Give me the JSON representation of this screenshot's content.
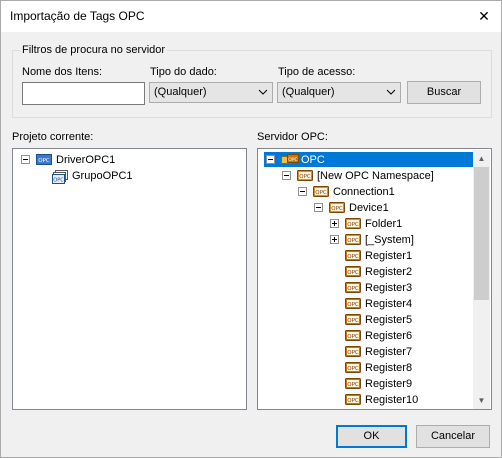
{
  "window": {
    "title": "Importação de Tags OPC",
    "close_glyph": "✕"
  },
  "filters": {
    "group_title": "Filtros de procura no servidor",
    "item_names_label": "Nome dos Itens:",
    "item_names_value": "",
    "data_type_label": "Tipo do dado:",
    "data_type_value": "(Qualquer)",
    "access_type_label": "Tipo de acesso:",
    "access_type_value": "(Qualquer)",
    "search_button": "Buscar"
  },
  "current_project": {
    "label": "Projeto corrente:",
    "items": [
      {
        "label": "DriverOPC1",
        "icon": "opc-driver-icon",
        "level": 0,
        "expander": "minus"
      },
      {
        "label": "GrupoOPC1",
        "icon": "opc-group-icon",
        "level": 1,
        "expander": "none"
      }
    ]
  },
  "opc_server": {
    "label": "Servidor OPC:",
    "items": [
      {
        "label": "OPC",
        "icon": "opc-server-icon",
        "level": 0,
        "expander": "minus",
        "selected": true
      },
      {
        "label": "[New OPC Namespace]",
        "icon": "opc-folder-icon",
        "level": 1,
        "expander": "minus"
      },
      {
        "label": "Connection1",
        "icon": "opc-folder-icon",
        "level": 2,
        "expander": "minus"
      },
      {
        "label": "Device1",
        "icon": "opc-folder-icon",
        "level": 3,
        "expander": "minus"
      },
      {
        "label": "Folder1",
        "icon": "opc-folder-icon",
        "level": 4,
        "expander": "plus"
      },
      {
        "label": "[_System]",
        "icon": "opc-folder-icon",
        "level": 4,
        "expander": "plus"
      },
      {
        "label": "Register1",
        "icon": "opc-tag-icon",
        "level": 4,
        "expander": "none"
      },
      {
        "label": "Register2",
        "icon": "opc-tag-icon",
        "level": 4,
        "expander": "none"
      },
      {
        "label": "Register3",
        "icon": "opc-tag-icon",
        "level": 4,
        "expander": "none"
      },
      {
        "label": "Register4",
        "icon": "opc-tag-icon",
        "level": 4,
        "expander": "none"
      },
      {
        "label": "Register5",
        "icon": "opc-tag-icon",
        "level": 4,
        "expander": "none"
      },
      {
        "label": "Register6",
        "icon": "opc-tag-icon",
        "level": 4,
        "expander": "none"
      },
      {
        "label": "Register7",
        "icon": "opc-tag-icon",
        "level": 4,
        "expander": "none"
      },
      {
        "label": "Register8",
        "icon": "opc-tag-icon",
        "level": 4,
        "expander": "none"
      },
      {
        "label": "Register9",
        "icon": "opc-tag-icon",
        "level": 4,
        "expander": "none"
      },
      {
        "label": "Register10",
        "icon": "opc-tag-icon",
        "level": 4,
        "expander": "none"
      }
    ]
  },
  "buttons": {
    "ok": "OK",
    "cancel": "Cancelar"
  },
  "colors": {
    "selection": "#0078d7",
    "accent": "#0078d7",
    "icon_orange": "#c8780a"
  }
}
